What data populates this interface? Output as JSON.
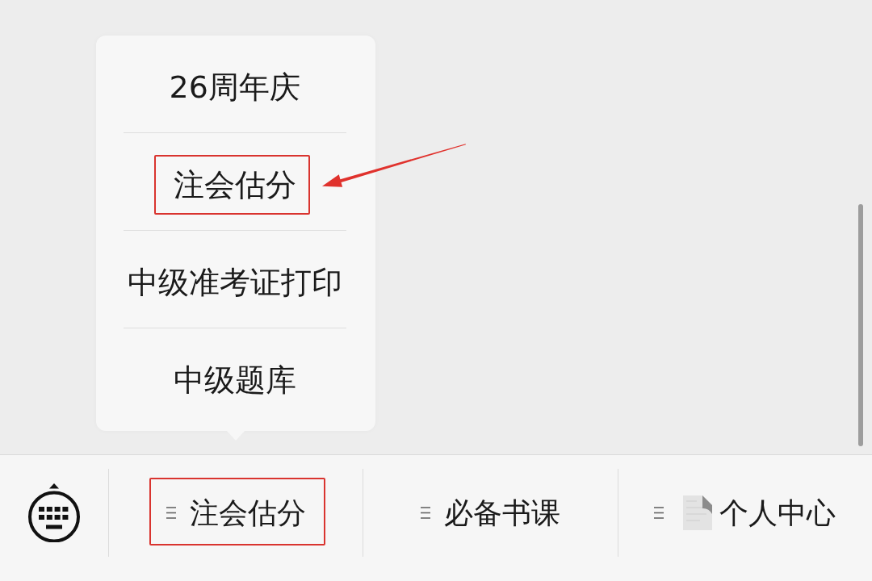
{
  "bottom_bar": {
    "tabs": [
      {
        "label": "注会估分",
        "kind": "menu",
        "highlighted": true,
        "menu": {
          "items": [
            {
              "label": "26周年庆",
              "highlighted": false,
              "pointed_at": false
            },
            {
              "label": "注会估分",
              "highlighted": true,
              "pointed_at": true
            },
            {
              "label": "中级准考证打印",
              "highlighted": false,
              "pointed_at": false
            },
            {
              "label": "中级题库",
              "highlighted": false,
              "pointed_at": false
            }
          ]
        }
      },
      {
        "label": "必备书课",
        "kind": "menu",
        "highlighted": false
      },
      {
        "label": "个人中心",
        "kind": "menu-with-image",
        "highlighted": false
      }
    ]
  }
}
